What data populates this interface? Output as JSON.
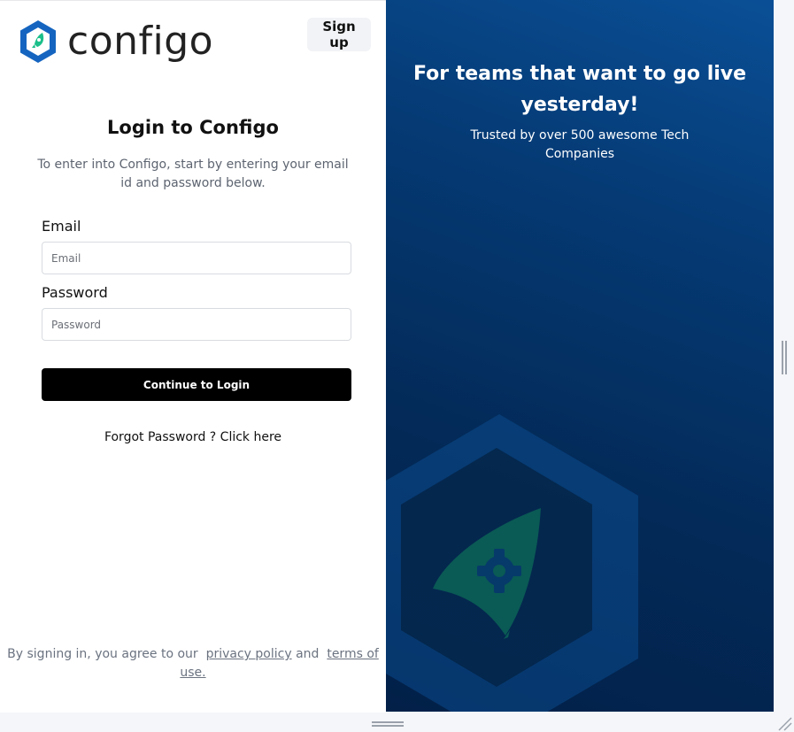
{
  "brand": {
    "name": "configo",
    "logo_icon": "rocket-hexagon-icon",
    "accent_color": "#1565c0",
    "rocket_color": "#1bbf8a"
  },
  "header": {
    "signup_label": "Sign up"
  },
  "login": {
    "title": "Login to Configo",
    "subtitle": "To enter into Configo, start by entering your email id and password below.",
    "email_label": "Email",
    "email_placeholder": "Email",
    "password_label": "Password",
    "password_placeholder": "Password",
    "submit_label": "Continue to Login",
    "forgot_label": "Forgot Password ? Click here"
  },
  "footer": {
    "prefix": "By signing in, you agree to our",
    "privacy_label": "privacy policy",
    "and_label": "and",
    "terms_label": "terms of use."
  },
  "promo": {
    "headline": "For teams that want to go live yesterday!",
    "subline": "Trusted by over 500 awesome Tech Companies",
    "background_icon": "rocket-hexagon-icon"
  }
}
